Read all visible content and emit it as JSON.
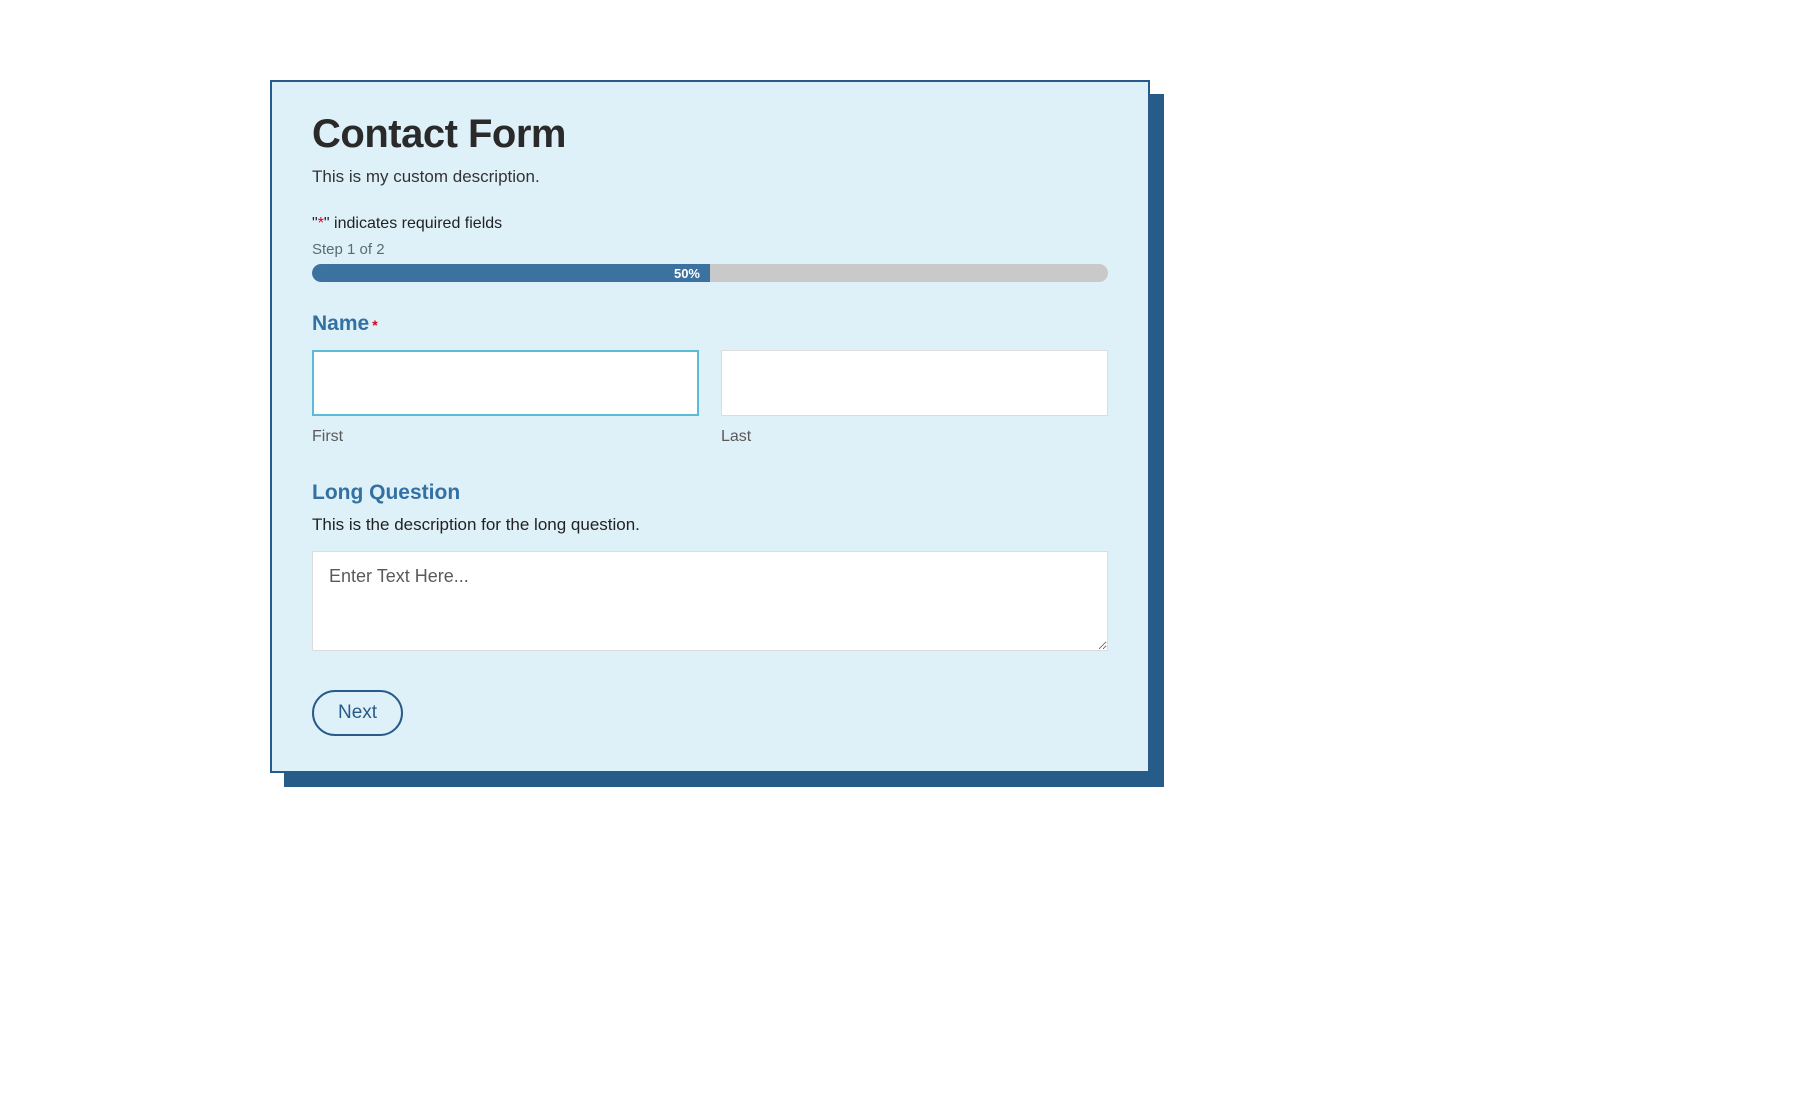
{
  "form": {
    "title": "Contact Form",
    "description": "This is my custom description.",
    "required_note_prefix": "\"",
    "required_note_asterisk": "*",
    "required_note_suffix": "\" indicates required fields",
    "step_label": "Step 1 of 2",
    "progress_percent": 50,
    "progress_text": "50%"
  },
  "fields": {
    "name": {
      "label": "Name",
      "required": true,
      "first_value": "",
      "last_value": "",
      "first_sublabel": "First",
      "last_sublabel": "Last"
    },
    "long_question": {
      "label": "Long Question",
      "description": "This is the description for the long question.",
      "placeholder": "Enter Text Here...",
      "value": ""
    }
  },
  "buttons": {
    "next": "Next"
  },
  "colors": {
    "card_bg": "#dff1f8",
    "card_border": "#265b8a",
    "accent": "#3371a3",
    "progress_fill": "#3b72a0",
    "required": "#d9001b"
  }
}
